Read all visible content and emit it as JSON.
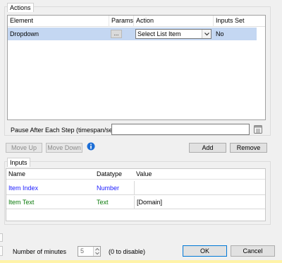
{
  "actions_section": {
    "label": "Actions",
    "columns": [
      "Element",
      "Params",
      "Action",
      "Inputs Set"
    ],
    "rows": [
      {
        "element": "Dropdown",
        "params": "...",
        "action": "Select List Item",
        "inputs_set": "No"
      }
    ]
  },
  "pause": {
    "label": "Pause After Each Step (timespan/secs)",
    "value": ""
  },
  "buttons": {
    "move_up": "Move Up",
    "move_down": "Move Down",
    "add": "Add",
    "remove": "Remove",
    "ok": "OK",
    "cancel": "Cancel"
  },
  "inputs_section": {
    "label": "Inputs",
    "columns": [
      "Name",
      "Datatype",
      "Value"
    ],
    "rows": [
      {
        "name": "Item Index",
        "datatype": "Number",
        "value": "",
        "color": "#1a1aff"
      },
      {
        "name": "Item Text",
        "datatype": "Text",
        "value": "[Domain]",
        "color": "#0a7a0a"
      }
    ]
  },
  "footer": {
    "minutes_label": "Number of minutes",
    "minutes_value": "5",
    "hint": "(0 to disable)"
  },
  "colors": {
    "selection": "#c4d7f2",
    "accent": "#0078d7"
  },
  "icons": {
    "info": "info-icon",
    "calendar": "calendar-icon",
    "dropdown": "chevron-down-icon"
  }
}
